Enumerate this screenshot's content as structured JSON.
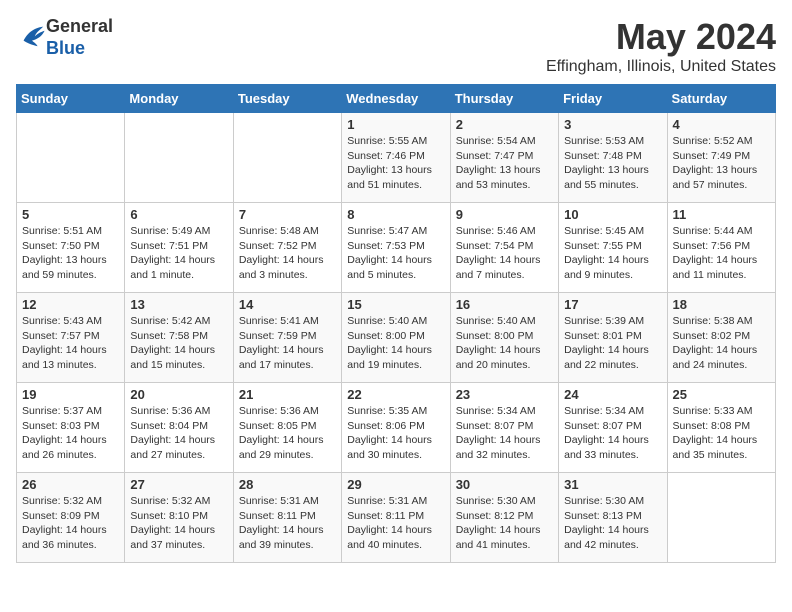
{
  "logo": {
    "general": "General",
    "blue": "Blue"
  },
  "header": {
    "month": "May 2024",
    "location": "Effingham, Illinois, United States"
  },
  "weekdays": [
    "Sunday",
    "Monday",
    "Tuesday",
    "Wednesday",
    "Thursday",
    "Friday",
    "Saturday"
  ],
  "weeks": [
    [
      {
        "day": "",
        "info": ""
      },
      {
        "day": "",
        "info": ""
      },
      {
        "day": "",
        "info": ""
      },
      {
        "day": "1",
        "info": "Sunrise: 5:55 AM\nSunset: 7:46 PM\nDaylight: 13 hours\nand 51 minutes."
      },
      {
        "day": "2",
        "info": "Sunrise: 5:54 AM\nSunset: 7:47 PM\nDaylight: 13 hours\nand 53 minutes."
      },
      {
        "day": "3",
        "info": "Sunrise: 5:53 AM\nSunset: 7:48 PM\nDaylight: 13 hours\nand 55 minutes."
      },
      {
        "day": "4",
        "info": "Sunrise: 5:52 AM\nSunset: 7:49 PM\nDaylight: 13 hours\nand 57 minutes."
      }
    ],
    [
      {
        "day": "5",
        "info": "Sunrise: 5:51 AM\nSunset: 7:50 PM\nDaylight: 13 hours\nand 59 minutes."
      },
      {
        "day": "6",
        "info": "Sunrise: 5:49 AM\nSunset: 7:51 PM\nDaylight: 14 hours\nand 1 minute."
      },
      {
        "day": "7",
        "info": "Sunrise: 5:48 AM\nSunset: 7:52 PM\nDaylight: 14 hours\nand 3 minutes."
      },
      {
        "day": "8",
        "info": "Sunrise: 5:47 AM\nSunset: 7:53 PM\nDaylight: 14 hours\nand 5 minutes."
      },
      {
        "day": "9",
        "info": "Sunrise: 5:46 AM\nSunset: 7:54 PM\nDaylight: 14 hours\nand 7 minutes."
      },
      {
        "day": "10",
        "info": "Sunrise: 5:45 AM\nSunset: 7:55 PM\nDaylight: 14 hours\nand 9 minutes."
      },
      {
        "day": "11",
        "info": "Sunrise: 5:44 AM\nSunset: 7:56 PM\nDaylight: 14 hours\nand 11 minutes."
      }
    ],
    [
      {
        "day": "12",
        "info": "Sunrise: 5:43 AM\nSunset: 7:57 PM\nDaylight: 14 hours\nand 13 minutes."
      },
      {
        "day": "13",
        "info": "Sunrise: 5:42 AM\nSunset: 7:58 PM\nDaylight: 14 hours\nand 15 minutes."
      },
      {
        "day": "14",
        "info": "Sunrise: 5:41 AM\nSunset: 7:59 PM\nDaylight: 14 hours\nand 17 minutes."
      },
      {
        "day": "15",
        "info": "Sunrise: 5:40 AM\nSunset: 8:00 PM\nDaylight: 14 hours\nand 19 minutes."
      },
      {
        "day": "16",
        "info": "Sunrise: 5:40 AM\nSunset: 8:00 PM\nDaylight: 14 hours\nand 20 minutes."
      },
      {
        "day": "17",
        "info": "Sunrise: 5:39 AM\nSunset: 8:01 PM\nDaylight: 14 hours\nand 22 minutes."
      },
      {
        "day": "18",
        "info": "Sunrise: 5:38 AM\nSunset: 8:02 PM\nDaylight: 14 hours\nand 24 minutes."
      }
    ],
    [
      {
        "day": "19",
        "info": "Sunrise: 5:37 AM\nSunset: 8:03 PM\nDaylight: 14 hours\nand 26 minutes."
      },
      {
        "day": "20",
        "info": "Sunrise: 5:36 AM\nSunset: 8:04 PM\nDaylight: 14 hours\nand 27 minutes."
      },
      {
        "day": "21",
        "info": "Sunrise: 5:36 AM\nSunset: 8:05 PM\nDaylight: 14 hours\nand 29 minutes."
      },
      {
        "day": "22",
        "info": "Sunrise: 5:35 AM\nSunset: 8:06 PM\nDaylight: 14 hours\nand 30 minutes."
      },
      {
        "day": "23",
        "info": "Sunrise: 5:34 AM\nSunset: 8:07 PM\nDaylight: 14 hours\nand 32 minutes."
      },
      {
        "day": "24",
        "info": "Sunrise: 5:34 AM\nSunset: 8:07 PM\nDaylight: 14 hours\nand 33 minutes."
      },
      {
        "day": "25",
        "info": "Sunrise: 5:33 AM\nSunset: 8:08 PM\nDaylight: 14 hours\nand 35 minutes."
      }
    ],
    [
      {
        "day": "26",
        "info": "Sunrise: 5:32 AM\nSunset: 8:09 PM\nDaylight: 14 hours\nand 36 minutes."
      },
      {
        "day": "27",
        "info": "Sunrise: 5:32 AM\nSunset: 8:10 PM\nDaylight: 14 hours\nand 37 minutes."
      },
      {
        "day": "28",
        "info": "Sunrise: 5:31 AM\nSunset: 8:11 PM\nDaylight: 14 hours\nand 39 minutes."
      },
      {
        "day": "29",
        "info": "Sunrise: 5:31 AM\nSunset: 8:11 PM\nDaylight: 14 hours\nand 40 minutes."
      },
      {
        "day": "30",
        "info": "Sunrise: 5:30 AM\nSunset: 8:12 PM\nDaylight: 14 hours\nand 41 minutes."
      },
      {
        "day": "31",
        "info": "Sunrise: 5:30 AM\nSunset: 8:13 PM\nDaylight: 14 hours\nand 42 minutes."
      },
      {
        "day": "",
        "info": ""
      }
    ]
  ]
}
